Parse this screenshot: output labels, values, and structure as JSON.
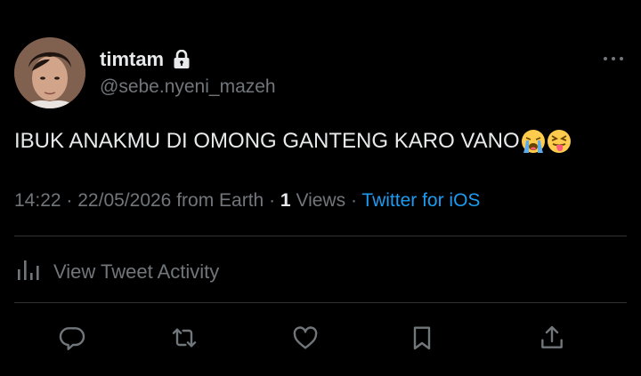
{
  "author": {
    "display_name": "timtam",
    "handle": "@sebe.nyeni_mazeh"
  },
  "tweet": {
    "text": "IBUK ANAKMU DI OMONG GANTENG KARO VANO"
  },
  "meta": {
    "time": "14:22",
    "date": "22/05/2026",
    "location": "from Earth",
    "views_count": "1",
    "views_label": "Views",
    "client": "Twitter for iOS",
    "sep": "·"
  },
  "activity": {
    "label": "View Tweet Activity"
  },
  "icons": {
    "lock": "lock-icon",
    "more": "more-icon",
    "reply": "reply-icon",
    "retweet": "retweet-icon",
    "like": "like-icon",
    "bookmark": "bookmark-icon",
    "share": "share-icon",
    "activity": "analytics-icon"
  },
  "colors": {
    "background": "#000000",
    "text": "#e7e9ea",
    "secondary": "#71767b",
    "accent": "#1d9bf0",
    "divider": "#2f3336"
  }
}
